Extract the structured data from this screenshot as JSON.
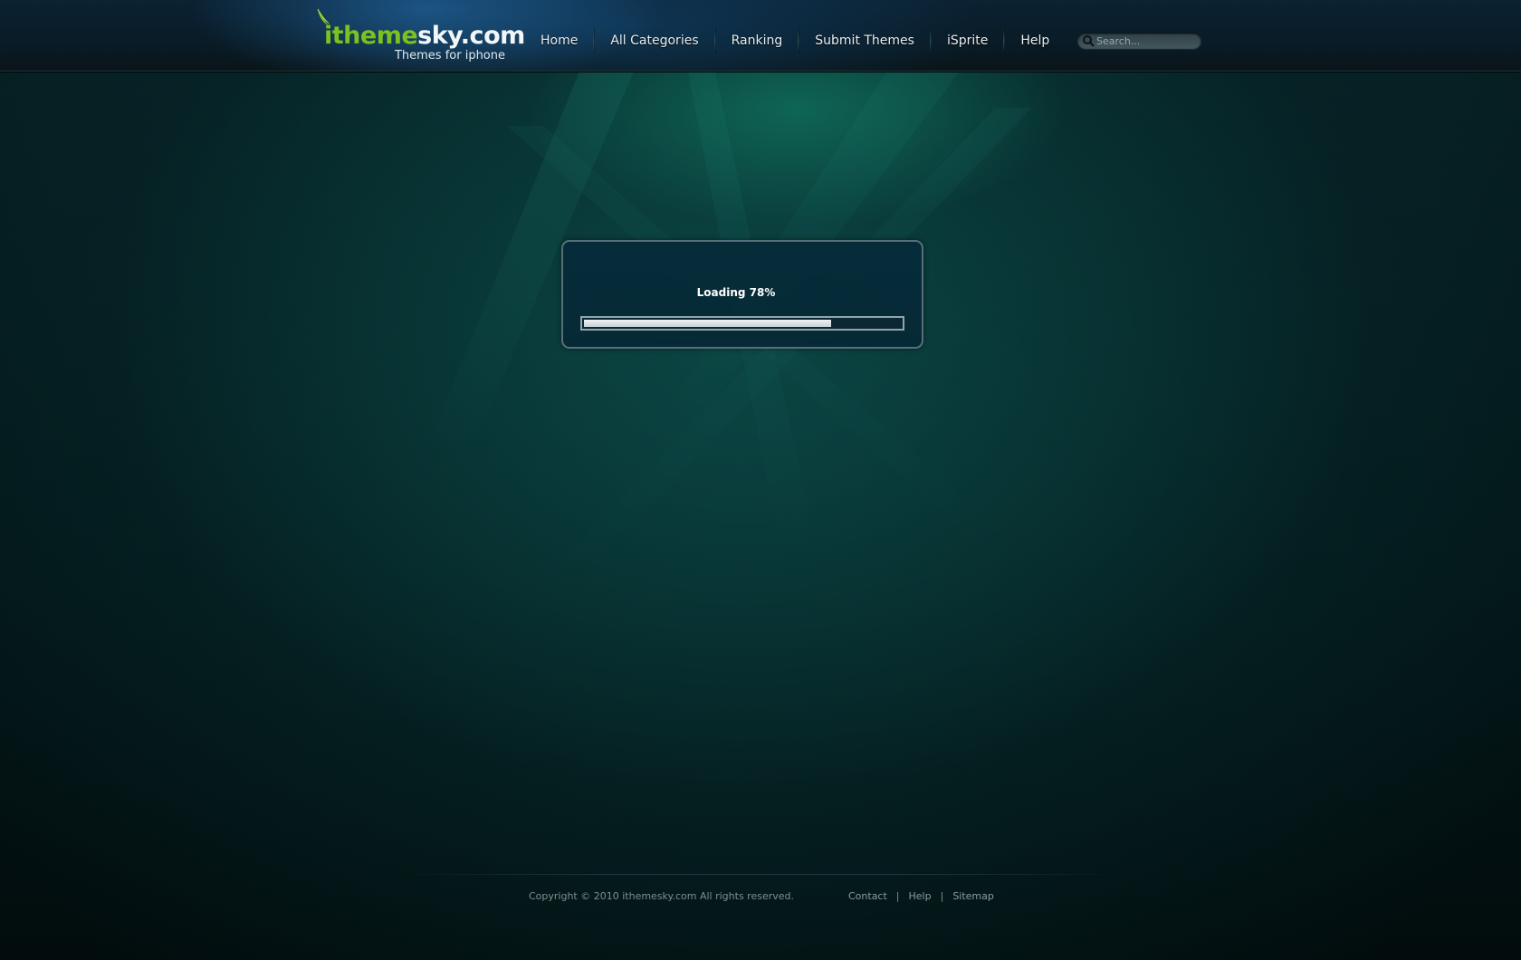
{
  "header": {
    "logo": {
      "part1": "itheme",
      "part2": "sky.com",
      "tagline": "Themes for iphone"
    },
    "nav": [
      {
        "label": "Home"
      },
      {
        "label": "All Categories"
      },
      {
        "label": "Ranking"
      },
      {
        "label": "Submit Themes"
      },
      {
        "label": "iSprite"
      },
      {
        "label": "Help"
      }
    ],
    "search": {
      "placeholder": "Search...",
      "value": ""
    }
  },
  "loader": {
    "label": "Loading 78%",
    "progress": 0.78
  },
  "footer": {
    "copyright": "Copyright © 2010 ithemesky.com All rights reserved.",
    "links": [
      {
        "label": "Contact"
      },
      {
        "label": "Help"
      },
      {
        "label": "Sitemap"
      }
    ],
    "separator": "|"
  },
  "colors": {
    "brand_green": "#7bc11f",
    "background": "#031618",
    "progress_fill": "#dde4e7"
  },
  "icons": {
    "logo": "leaf-icon",
    "search": "search-icon"
  }
}
